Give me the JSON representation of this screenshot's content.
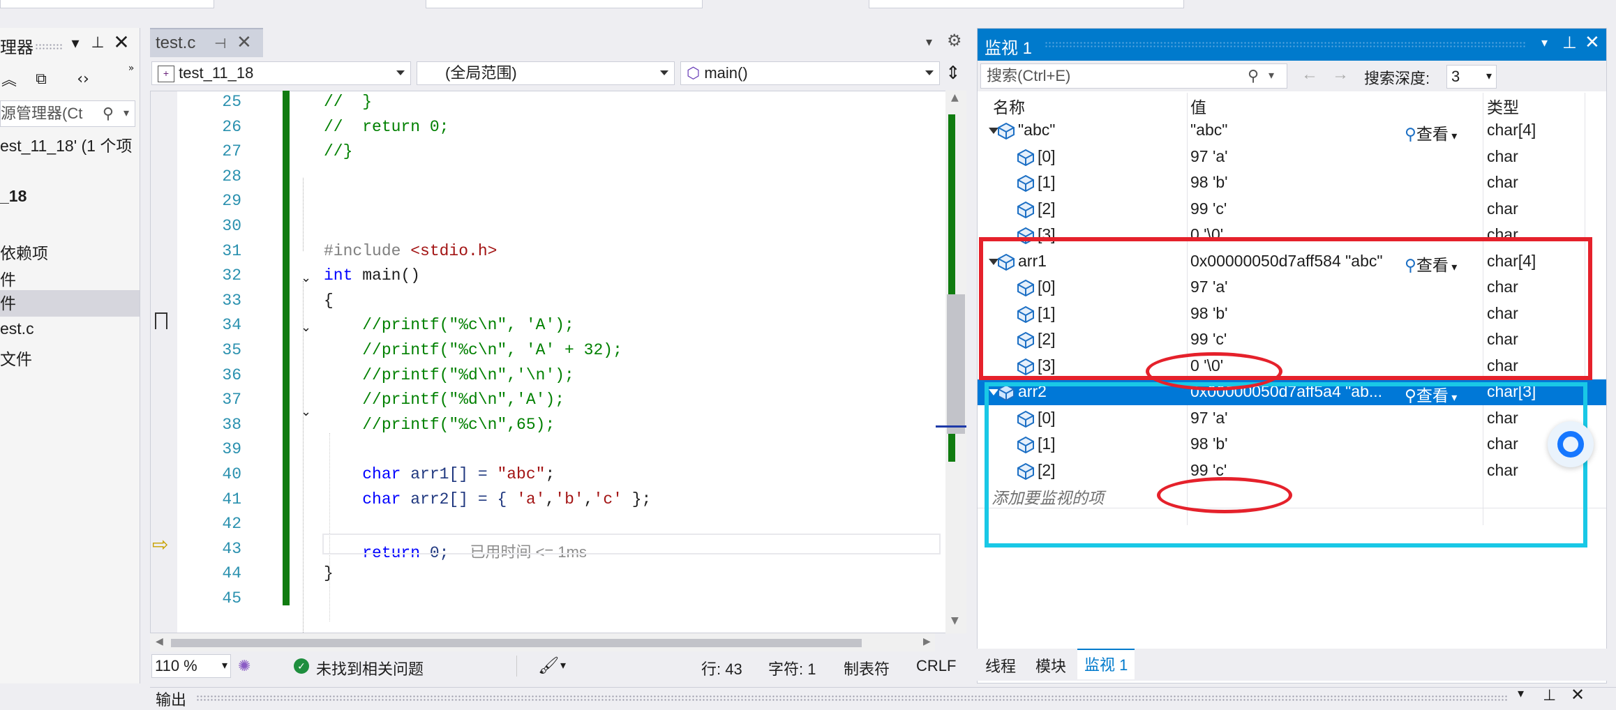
{
  "left": {
    "title": "理器",
    "search_placeholder": "源管理器(Ct",
    "tree": [
      "est_11_18' (1 个项",
      "_18",
      "依赖项",
      "件",
      "件",
      "est.c",
      "文件"
    ]
  },
  "editor": {
    "tab": "test.c",
    "nav": {
      "project": "test_11_18",
      "scope": "(全局范围)",
      "member": "main()"
    },
    "lines": [
      {
        "n": "25",
        "t": "//  }",
        "cls": "cm"
      },
      {
        "n": "26",
        "t": "//  return 0;",
        "cls": "cm"
      },
      {
        "n": "27",
        "t": "//}",
        "cls": "cm"
      },
      {
        "n": "28",
        "t": "",
        "cls": ""
      },
      {
        "n": "29",
        "t": "",
        "cls": ""
      },
      {
        "n": "30",
        "t": "",
        "cls": ""
      },
      {
        "n": "31",
        "t": "#include",
        "t2": " <stdio.h>",
        "cls": "pp",
        "cls2": "st"
      },
      {
        "n": "32",
        "t": "int",
        "t2": " main()",
        "cls": "kw",
        "cls2": ""
      },
      {
        "n": "33",
        "t": "{",
        "cls": ""
      },
      {
        "n": "34",
        "t": "    //printf(\"%c\\n\", 'A');",
        "cls": "cm"
      },
      {
        "n": "35",
        "t": "    //printf(\"%c\\n\", 'A' + 32);",
        "cls": "cm"
      },
      {
        "n": "36",
        "t": "    //printf(\"%d\\n\",'\\n');",
        "cls": "cm"
      },
      {
        "n": "37",
        "t": "    //printf(\"%d\\n\",'A');",
        "cls": "cm"
      },
      {
        "n": "38",
        "t": "    //printf(\"%c\\n\",65);",
        "cls": "cm"
      },
      {
        "n": "39",
        "t": "",
        "cls": ""
      },
      {
        "n": "40",
        "t": "    char",
        "t2": " arr1[] = ",
        "t3": "\"abc\"",
        "t4": ";",
        "cls": "kw"
      },
      {
        "n": "41",
        "t": "    char",
        "t2": " arr2[] = { ",
        "t3": "'a'",
        "t4": ",",
        "t5": "'b'",
        "t6": ",",
        "t7": "'c'",
        "t8": " };",
        "cls": "kw"
      },
      {
        "n": "42",
        "t": "",
        "cls": ""
      },
      {
        "n": "43",
        "t": "    return",
        "t2": " 0;",
        "hint": "已用时间 <= 1ms",
        "cls": "kw"
      },
      {
        "n": "44",
        "t": "}",
        "cls": ""
      },
      {
        "n": "45",
        "t": "",
        "cls": ""
      }
    ],
    "status": {
      "zoom": "110 %",
      "issues": "未找到相关问题",
      "line": "行: 43",
      "char": "字符: 1",
      "tabs": "制表符",
      "eol": "CRLF"
    }
  },
  "watch": {
    "title": "监视 1",
    "search_placeholder": "搜索(Ctrl+E)",
    "search_depth_label": "搜索深度:",
    "search_depth": "3",
    "columns": {
      "name": "名称",
      "value": "值",
      "type": "类型"
    },
    "look": "查看",
    "rows": [
      {
        "name": "\"abc\"",
        "value": "\"abc\"",
        "type": "char[4]",
        "level": 0,
        "look": true
      },
      {
        "name": "[0]",
        "value": "97 'a'",
        "type": "char",
        "level": 1
      },
      {
        "name": "[1]",
        "value": "98 'b'",
        "type": "char",
        "level": 1
      },
      {
        "name": "[2]",
        "value": "99 'c'",
        "type": "char",
        "level": 1
      },
      {
        "name": "[3]",
        "value": "0 '\\0'",
        "type": "char",
        "level": 1
      },
      {
        "name": "arr1",
        "value": "0x00000050d7aff584 \"abc\"",
        "type": "char[4]",
        "level": 0,
        "look": true
      },
      {
        "name": "[0]",
        "value": "97 'a'",
        "type": "char",
        "level": 1
      },
      {
        "name": "[1]",
        "value": "98 'b'",
        "type": "char",
        "level": 1
      },
      {
        "name": "[2]",
        "value": "99 'c'",
        "type": "char",
        "level": 1
      },
      {
        "name": "[3]",
        "value": "0 '\\0'",
        "type": "char",
        "level": 1
      },
      {
        "name": "arr2",
        "value": "0x00000050d7aff5a4 \"ab...",
        "type": "char[3]",
        "level": 0,
        "look": true,
        "selected": true
      },
      {
        "name": "[0]",
        "value": "97 'a'",
        "type": "char",
        "level": 1
      },
      {
        "name": "[1]",
        "value": "98 'b'",
        "type": "char",
        "level": 1
      },
      {
        "name": "[2]",
        "value": "99 'c'",
        "type": "char",
        "level": 1
      }
    ],
    "add_watch": "添加要监视的项",
    "tabs": [
      "线程",
      "模块",
      "监视 1"
    ]
  },
  "output": {
    "title": "输出"
  },
  "colors": {
    "accent": "#007acc",
    "annotation_red": "#e5212b",
    "annotation_cyan": "#19c8e6",
    "green_bar": "#107c10"
  }
}
